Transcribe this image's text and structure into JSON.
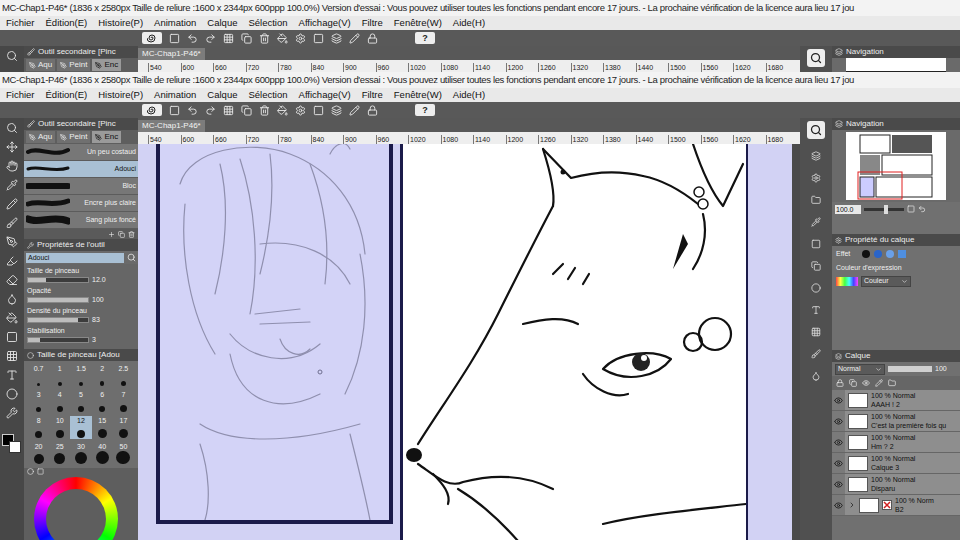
{
  "windows": [
    {
      "title": "MC-Chap1-P46* (1836 x 2580px Taille de reliure :1600 x 2344px 600ppp 100.0%)  Version d'essai : Vous pouvez utiliser toutes les fonctions pendant encore 17 jours. - La prochaine vérification de la licence aura lieu 17 jou",
      "menu": [
        "Fichier",
        "Édition(E)",
        "Histoire(P)",
        "Animation",
        "Calque",
        "Sélection",
        "Affichage(V)",
        "Filtre",
        "Fenêtre(W)",
        "Aide(H)"
      ],
      "help": "?",
      "sub_tool": {
        "title": "Outil secondaire [Pinc",
        "tabs": [
          {
            "label": "Aqu",
            "selected": false
          },
          {
            "label": "Peint",
            "selected": false
          },
          {
            "label": "Enc",
            "selected": true
          }
        ]
      },
      "document_tab": "MC-Chap1-P46*",
      "ruler": [
        "540",
        "600",
        "660",
        "720",
        "780",
        "840",
        "900",
        "960",
        "1020",
        "1080",
        "1140",
        "1200",
        "1260",
        "1320",
        "1380",
        "1440",
        "1500",
        "1560",
        "1620",
        "1680"
      ],
      "navigation_title": "Navigation"
    },
    {
      "title": "MC-Chap1-P46* (1836 x 2580px Taille de reliure :1600 x 2344px 600ppp 100.0%)  Version d'essai : Vous pouvez utiliser toutes les fonctions pendant encore 17 jours. - La prochaine vérification de la licence aura lieu 17 jou",
      "menu": [
        "Fichier",
        "Édition(E)",
        "Histoire(P)",
        "Animation",
        "Calque",
        "Sélection",
        "Affichage(V)",
        "Filtre",
        "Fenêtre(W)",
        "Aide(H)"
      ],
      "help": "?",
      "sub_tool": {
        "title": "Outil secondaire [Pinc",
        "tabs": [
          {
            "label": "Aqu",
            "selected": false
          },
          {
            "label": "Peint",
            "selected": false
          },
          {
            "label": "Enc",
            "selected": true
          }
        ]
      },
      "document_tab": "MC-Chap1-P46*",
      "ruler": [
        "540",
        "600",
        "660",
        "720",
        "780",
        "840",
        "900",
        "960",
        "1020",
        "1080",
        "1140",
        "1200",
        "1260",
        "1320",
        "1380",
        "1440",
        "1500",
        "1560",
        "1620",
        "1680"
      ],
      "navigation_title": "Navigation"
    }
  ],
  "brushes": [
    {
      "name": "Un peu costaud",
      "selected": false
    },
    {
      "name": "Adouci",
      "selected": true
    },
    {
      "name": "Bloc",
      "selected": false
    },
    {
      "name": "Encre plus claire",
      "selected": false
    },
    {
      "name": "Sang plus foncé",
      "selected": false
    }
  ],
  "tool_property": {
    "title": "Propriétés de l'outil",
    "preset": "Adouci",
    "settings": [
      {
        "label": "Taille de pinceau",
        "value": "12.0",
        "level": 0.3
      },
      {
        "label": "Opacité",
        "value": "100",
        "level": 1
      },
      {
        "label": "Densité du pinceau",
        "value": "83",
        "level": 0.83
      },
      {
        "label": "Stabilisation",
        "value": "3",
        "level": 0.2
      }
    ]
  },
  "brush_size": {
    "title": "Taille de pinceau [Adou",
    "sizes": [
      {
        "label": "0.7",
        "selected": false
      },
      {
        "label": "1",
        "selected": false
      },
      {
        "label": "1.5",
        "selected": false
      },
      {
        "label": "2",
        "selected": false
      },
      {
        "label": "2.5",
        "selected": false
      },
      {
        "label": "3",
        "selected": false
      },
      {
        "label": "4",
        "selected": false
      },
      {
        "label": "5",
        "selected": false
      },
      {
        "label": "6",
        "selected": false
      },
      {
        "label": "7",
        "selected": false
      },
      {
        "label": "8",
        "selected": false
      },
      {
        "label": "10",
        "selected": false
      },
      {
        "label": "12",
        "selected": true
      },
      {
        "label": "15",
        "selected": false
      },
      {
        "label": "17",
        "selected": false
      },
      {
        "label": "20",
        "selected": false
      },
      {
        "label": "25",
        "selected": false
      },
      {
        "label": "30",
        "selected": false
      },
      {
        "label": "40",
        "selected": false
      },
      {
        "label": "50",
        "selected": false
      }
    ]
  },
  "navigation": {
    "zoom": "100.0",
    "zoom_level": 0.5
  },
  "layer_property": {
    "title": "Propriété du calque",
    "effect_label": "Effet",
    "expression_label": "Couleur d'expression",
    "expression_value": "Couleur"
  },
  "layers": {
    "title": "Calque",
    "blend": "Normal",
    "opacity": "100",
    "opacity_level": 1,
    "items": [
      {
        "blend": "100 % Normal",
        "name": "AAAH ! 2",
        "kind": "layer",
        "visible": true
      },
      {
        "blend": "100 % Normal",
        "name": "C'est la première fois qu",
        "kind": "layer",
        "visible": true
      },
      {
        "blend": "100 % Normal",
        "name": "Hm ? 2",
        "kind": "layer",
        "visible": true
      },
      {
        "blend": "100 % Normal",
        "name": "Calque 3",
        "kind": "layer",
        "visible": true
      },
      {
        "blend": "100 % Normal",
        "name": "Disparu",
        "kind": "layer",
        "visible": true
      },
      {
        "blend": "100 % Norm",
        "name": "B2",
        "kind": "folder",
        "visible": true
      }
    ]
  }
}
